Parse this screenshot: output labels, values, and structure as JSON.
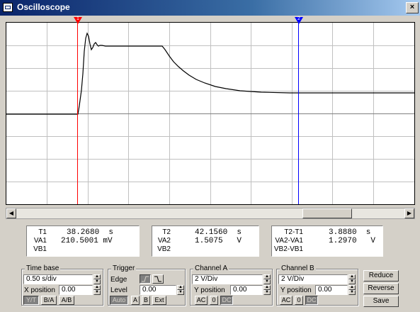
{
  "window": {
    "title": "Oscilloscope",
    "close_label": "×"
  },
  "cursors": {
    "t1_tag": "1",
    "t2_tag": "2",
    "t1_color": "#ff0000",
    "t2_color": "#0000ff"
  },
  "trace_color": "#000000",
  "readout": {
    "t1": {
      "labels": [
        "T1",
        "VA1",
        "VB1"
      ],
      "values": [
        "38.2680  s",
        "210.5001 mV",
        ""
      ]
    },
    "t2": {
      "labels": [
        "T2",
        "VA2",
        "VB2"
      ],
      "values": [
        "42.1560  s",
        "1.5075   V",
        ""
      ]
    },
    "diff": {
      "labels": [
        "T2-T1",
        "VA2-VA1",
        "VB2-VB1"
      ],
      "values": [
        "3.8880  s",
        "1.2970   V",
        ""
      ]
    }
  },
  "timebase": {
    "title": "Time base",
    "scale": "0.50 s/div",
    "xpos_label": "X position",
    "xpos": "0.00",
    "buttons": [
      "Y/T",
      "B/A",
      "A/B"
    ]
  },
  "trigger": {
    "title": "Trigger",
    "edge_label": "Edge",
    "level_label": "Level",
    "level": "0.00",
    "buttons": [
      "Auto",
      "A",
      "B",
      "Ext"
    ]
  },
  "channel_a": {
    "title": "Channel A",
    "scale": "2 V/Div",
    "ypos_label": "Y position",
    "ypos": "0.00",
    "coupling": [
      "AC",
      "0",
      "DC"
    ]
  },
  "channel_b": {
    "title": "Channel B",
    "scale": "2 V/Div",
    "ypos_label": "Y position",
    "ypos": "0.00",
    "coupling": [
      "AC",
      "0",
      "DC"
    ]
  },
  "actions": {
    "reduce": "Reduce",
    "reverse": "Reverse",
    "save": "Save"
  }
}
